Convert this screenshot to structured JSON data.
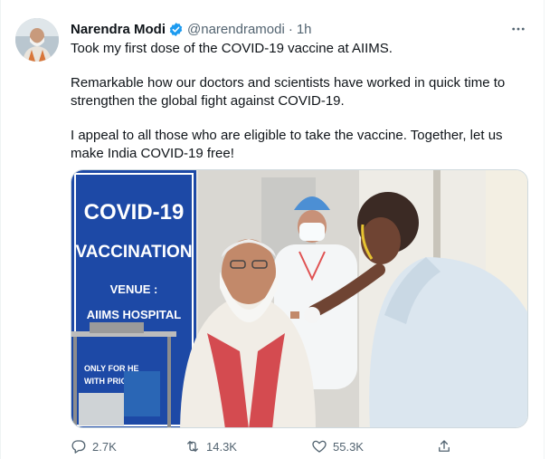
{
  "tweet": {
    "author_name": "Narendra Modi",
    "handle": "@narendramodi",
    "separator": "·",
    "time": "1h",
    "more_label": "•••",
    "lines": [
      "Took my first dose of the COVID-19 vaccine at AIIMS.",
      "Remarkable how our doctors and scientists have worked in quick time to strengthen the global fight against COVID-19.",
      "I appeal to all those who are eligible to take the vaccine. Together, let us make India COVID-19 free!"
    ]
  },
  "media": {
    "banner": {
      "line1": "COVID-19",
      "line2": "VACCINATION",
      "line3": "VENUE :",
      "line4": "AIIMS HOSPITAL",
      "line5": "ONLY FOR HE",
      "line6": "WITH PRIOR"
    }
  },
  "actions": {
    "reply_count": "2.7K",
    "retweet_count": "14.3K",
    "like_count": "55.3K"
  },
  "icons": {
    "verified": "verified-badge-icon",
    "more": "more-icon",
    "reply": "reply-icon",
    "retweet": "retweet-icon",
    "like": "heart-icon",
    "share": "share-icon"
  },
  "colors": {
    "verified_blue": "#1d9bf0",
    "secondary_text": "#536471",
    "banner_blue": "#1d49a6"
  }
}
